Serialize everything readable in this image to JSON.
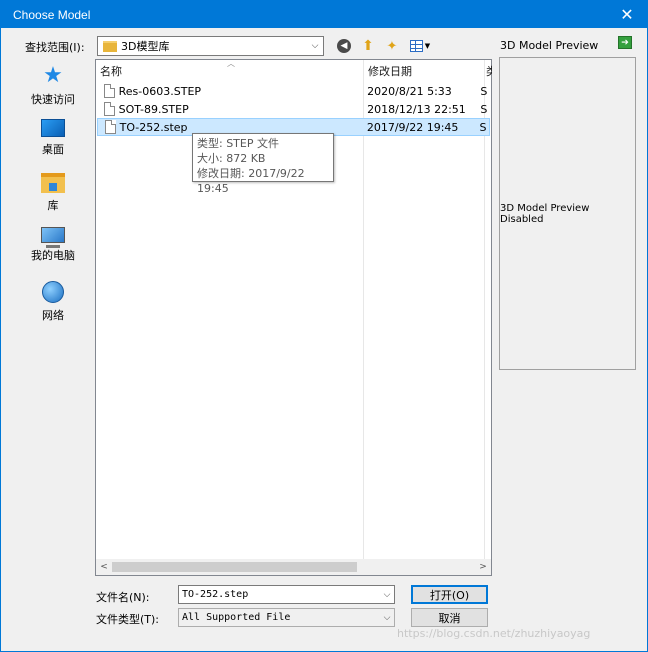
{
  "window": {
    "title": "Choose Model",
    "close_glyph": "✕"
  },
  "lookin": {
    "label": "查找范围(I):",
    "value": "3D模型库",
    "arrow": "⌵"
  },
  "toolbar": {
    "back": "◀",
    "up": "⬆",
    "newfolder": "✦",
    "views_dd": "▼"
  },
  "places": [
    {
      "label": "快速访问",
      "icon": "quick-access-icon"
    },
    {
      "label": "桌面",
      "icon": "desktop-icon"
    },
    {
      "label": "库",
      "icon": "library-icon"
    },
    {
      "label": "我的电脑",
      "icon": "computer-icon"
    },
    {
      "label": "网络",
      "icon": "network-icon"
    }
  ],
  "columns": {
    "name": "名称",
    "date": "修改日期",
    "type": "类"
  },
  "files": [
    {
      "name": "Res-0603.STEP",
      "date": "2020/8/21 5:33",
      "type": "S"
    },
    {
      "name": "SOT-89.STEP",
      "date": "2018/12/13 22:51",
      "type": "S"
    },
    {
      "name": "TO-252.step",
      "date": "2017/9/22 19:45",
      "type": "S"
    }
  ],
  "tooltip": {
    "line1": "类型: STEP 文件",
    "line2": "大小: 872 KB",
    "line3": "修改日期: 2017/9/22 19:45"
  },
  "scroll": {
    "left": "<",
    "right": ">"
  },
  "preview": {
    "label": "3D Model Preview",
    "message": "3D Model Preview Disabled",
    "toggle": "➔"
  },
  "form": {
    "filename_label": "文件名(N):",
    "filename_value": "TO-252.step",
    "filetype_label": "文件类型(T):",
    "filetype_value": "All Supported File",
    "open_label": "打开(O)",
    "cancel_label": "取消"
  },
  "watermark": "https://blog.csdn.net/zhuzhiyaoyag"
}
